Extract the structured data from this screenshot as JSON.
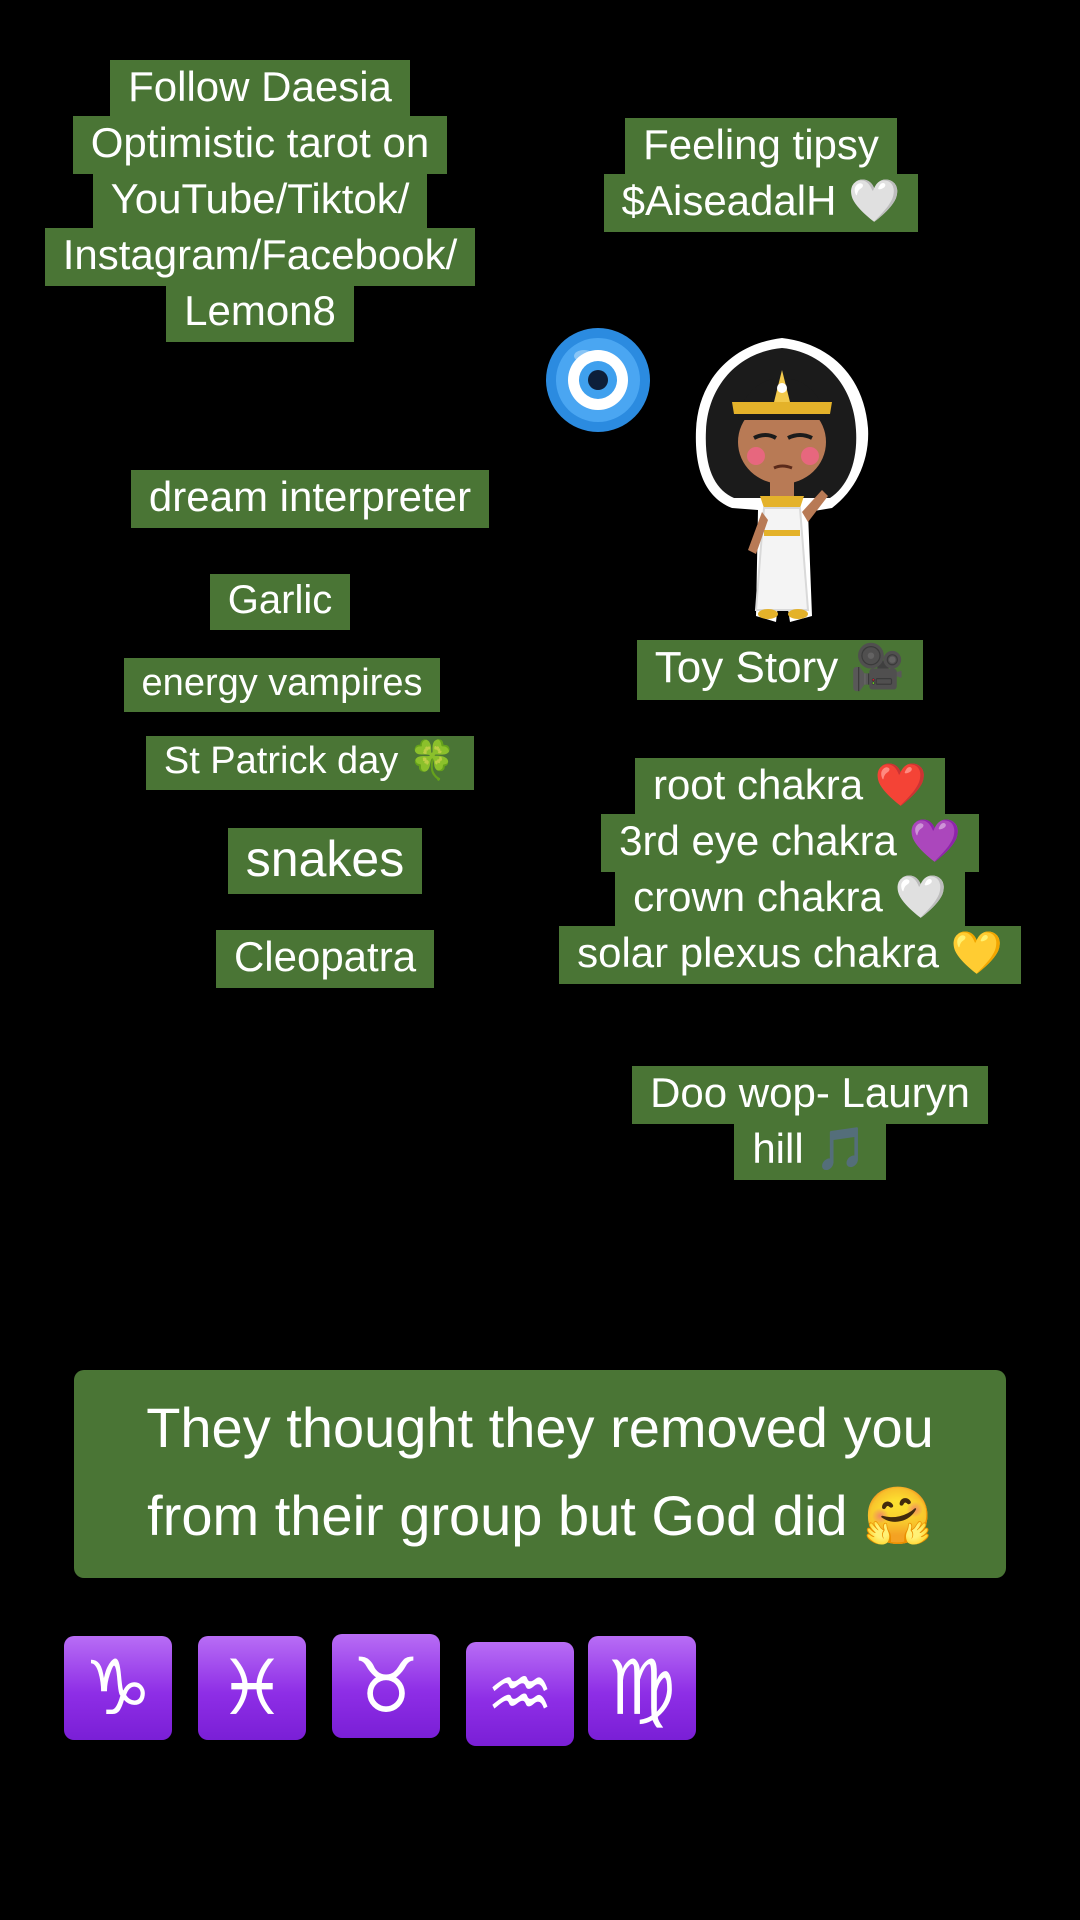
{
  "captions": {
    "follow": [
      "Follow Daesia",
      "Optimistic tarot on",
      "YouTube/Tiktok/",
      "Instagram/Facebook/",
      "Lemon8"
    ],
    "tipsy": [
      "Feeling tipsy",
      "$AiseadalH 🤍"
    ],
    "dream": "dream interpreter",
    "garlic": "Garlic",
    "energy": "energy vampires",
    "patrick": "St Patrick day 🍀",
    "snakes": "snakes",
    "cleopatra": "Cleopatra",
    "toystory": "Toy Story 🎥",
    "chakras": [
      "root chakra ❤️",
      "3rd eye chakra 💜",
      "crown chakra 🤍",
      "solar plexus chakra 💛"
    ],
    "doowop": [
      "Doo wop- Lauryn",
      "hill 🎵"
    ]
  },
  "main_message": {
    "line1": "They thought they removed you",
    "line2": "from their group but God did 🤗"
  },
  "zodiac_signs": [
    {
      "symbol": "♑",
      "name": "capricorn"
    },
    {
      "symbol": "♓",
      "name": "pisces"
    },
    {
      "symbol": "♉",
      "name": "taurus"
    },
    {
      "symbol": "♒",
      "name": "aquarius"
    },
    {
      "symbol": "♍",
      "name": "virgo"
    }
  ],
  "colors": {
    "background": "#000000",
    "caption_bg": "#4a7535",
    "text": "#ffffff",
    "zodiac_bg": "#8e2ee6"
  },
  "icons": {
    "evil_eye": "nazar-amulet-icon",
    "sticker": "cleopatra-sticker"
  }
}
